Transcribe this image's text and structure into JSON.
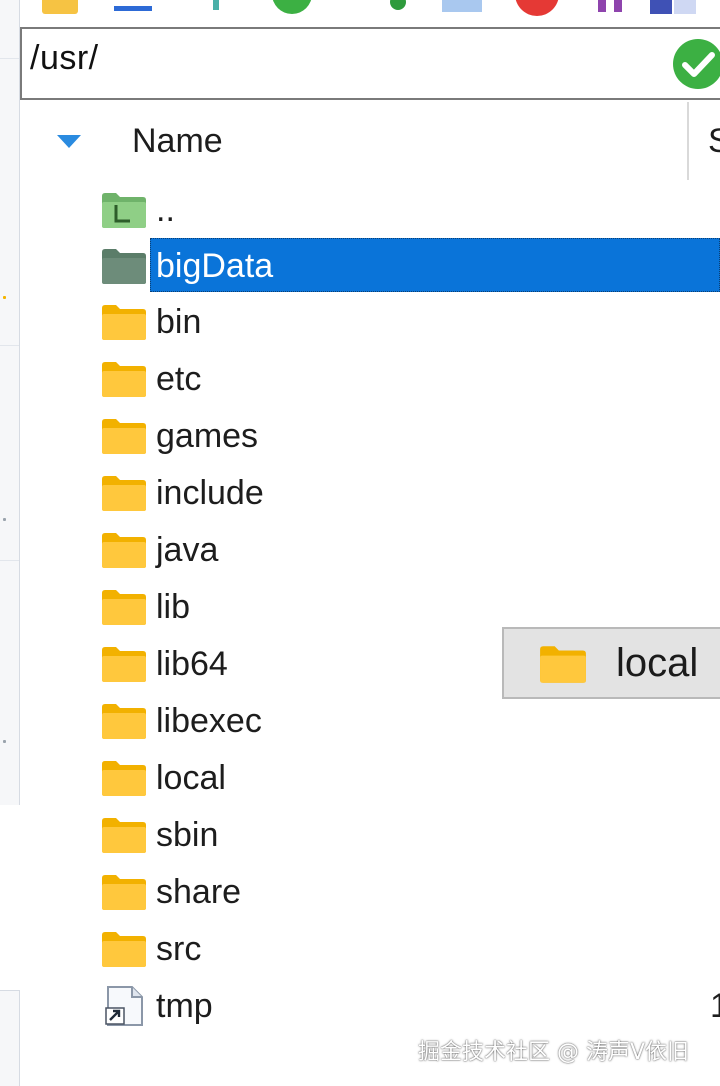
{
  "address_bar": {
    "path": "/usr/"
  },
  "columns": {
    "name": "Name",
    "size_partial": "S"
  },
  "files": [
    {
      "name": "..",
      "icon": "parent-folder-icon",
      "selected": false
    },
    {
      "name": "bigData",
      "icon": "folder-icon",
      "selected": true
    },
    {
      "name": "bin",
      "icon": "folder-icon",
      "selected": false
    },
    {
      "name": "etc",
      "icon": "folder-icon",
      "selected": false
    },
    {
      "name": "games",
      "icon": "folder-icon",
      "selected": false
    },
    {
      "name": "include",
      "icon": "folder-icon",
      "selected": false
    },
    {
      "name": "java",
      "icon": "folder-icon",
      "selected": false
    },
    {
      "name": "lib",
      "icon": "folder-icon",
      "selected": false
    },
    {
      "name": "lib64",
      "icon": "folder-icon",
      "selected": false
    },
    {
      "name": "libexec",
      "icon": "folder-icon",
      "selected": false
    },
    {
      "name": "local",
      "icon": "folder-icon",
      "selected": false
    },
    {
      "name": "sbin",
      "icon": "folder-icon",
      "selected": false
    },
    {
      "name": "share",
      "icon": "folder-icon",
      "selected": false
    },
    {
      "name": "src",
      "icon": "folder-icon",
      "selected": false
    },
    {
      "name": "tmp",
      "icon": "symlink-icon",
      "selected": false,
      "size_partial": "1"
    }
  ],
  "drag_ghost": {
    "label": "local"
  },
  "watermark": "掘金技术社区 @ 涛声V依旧",
  "colors": {
    "folder": "#FFC107",
    "selection": "#0A74D9",
    "ok_button": "#3CB043"
  }
}
